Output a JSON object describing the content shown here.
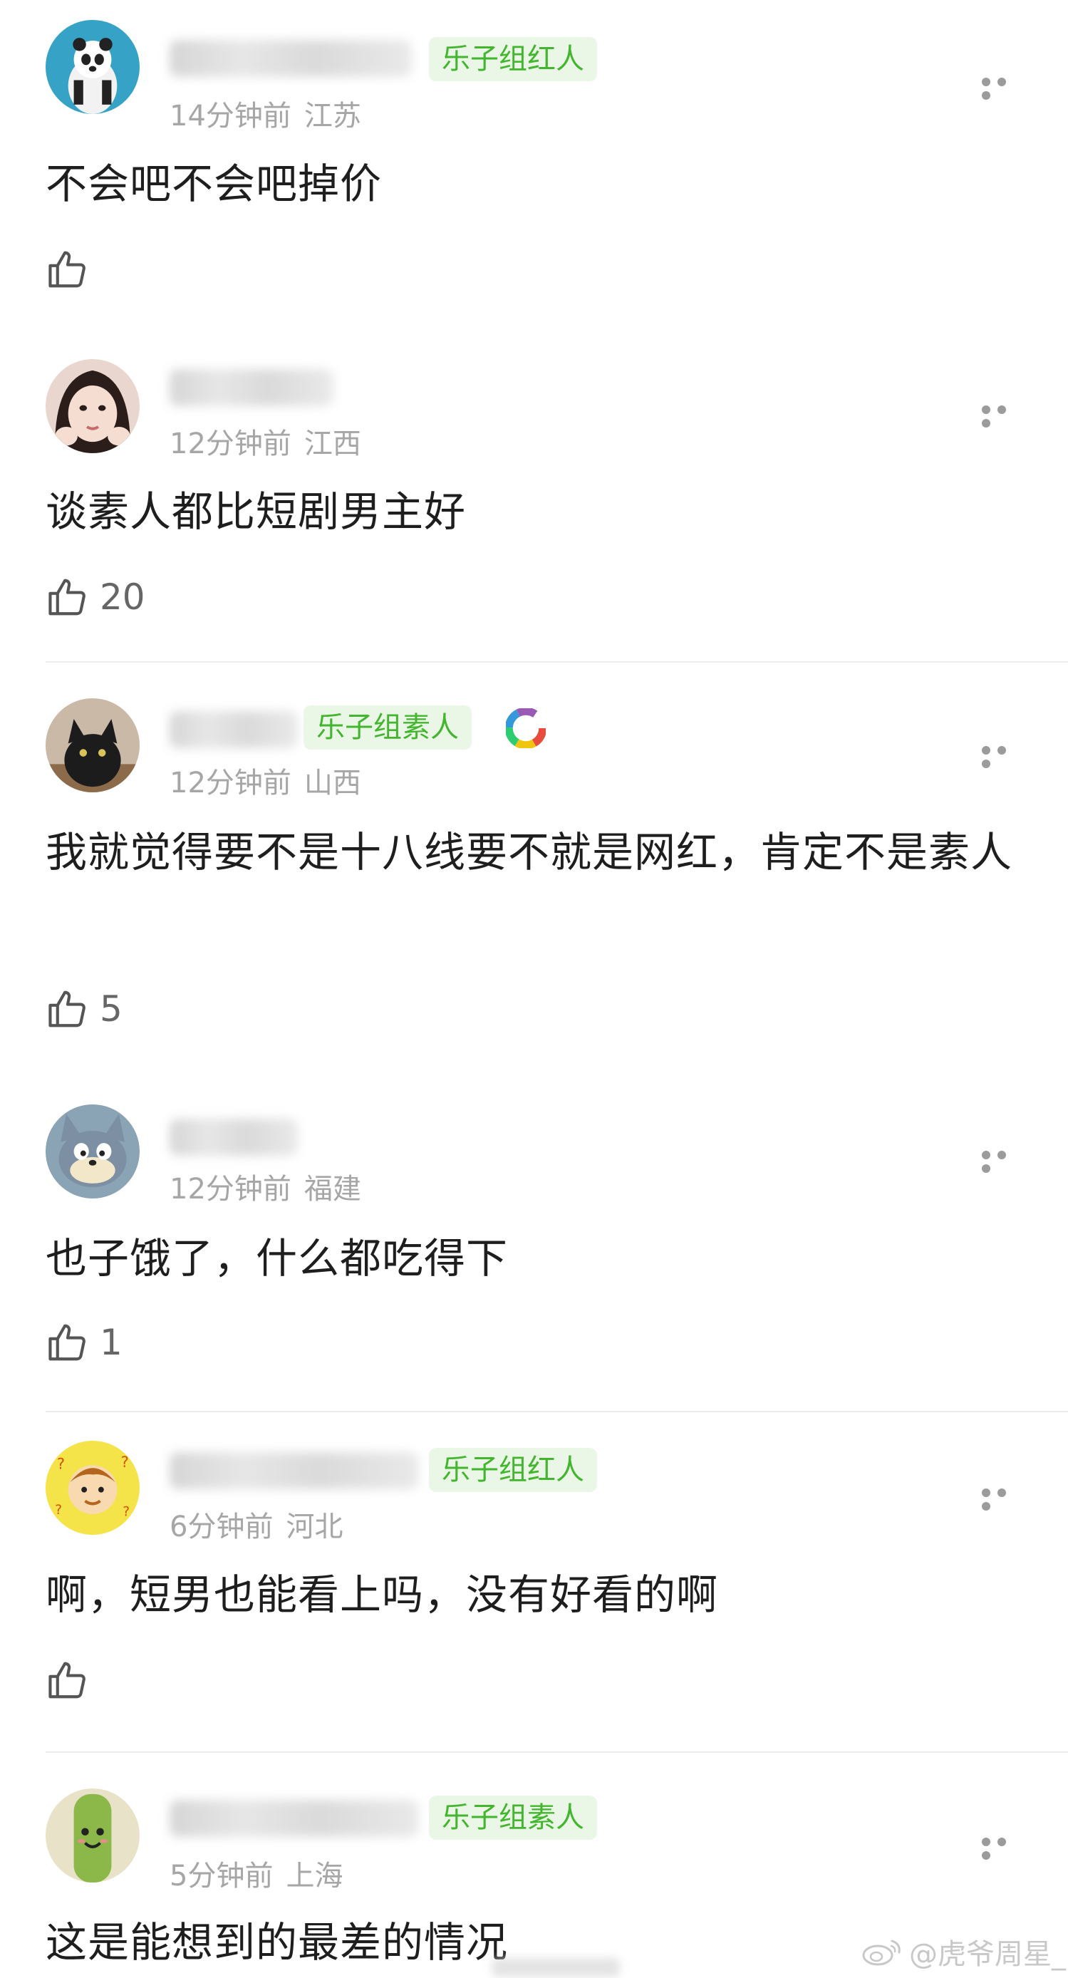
{
  "comments": [
    {
      "badge": "乐子组红人",
      "time": "14分钟前",
      "location": "江苏",
      "text": "不会吧不会吧掉价",
      "likes": ""
    },
    {
      "badge": "",
      "time": "12分钟前",
      "location": "江西",
      "text": "谈素人都比短剧男主好",
      "likes": "20"
    },
    {
      "badge": "乐子组素人",
      "time": "12分钟前",
      "location": "山西",
      "text": "我就觉得要不是十八线要不就是网红，肯定不是素人",
      "likes": "5"
    },
    {
      "badge": "",
      "time": "12分钟前",
      "location": "福建",
      "text": "也子饿了，什么都吃得下",
      "likes": "1"
    },
    {
      "badge": "乐子组红人",
      "time": "6分钟前",
      "location": "河北",
      "text": "啊，短男也能看上吗，没有好看的啊",
      "likes": ""
    },
    {
      "badge": "乐子组素人",
      "time": "5分钟前",
      "location": "上海",
      "text": "这是能想到的最差的情况",
      "likes": ""
    }
  ],
  "watermark": "@虎爷周星_",
  "colors": {
    "badge_bg": "#eaf7e7",
    "badge_text": "#43b52e",
    "meta_text": "#a6a6a6",
    "icon_gray": "#9b9b9b"
  }
}
